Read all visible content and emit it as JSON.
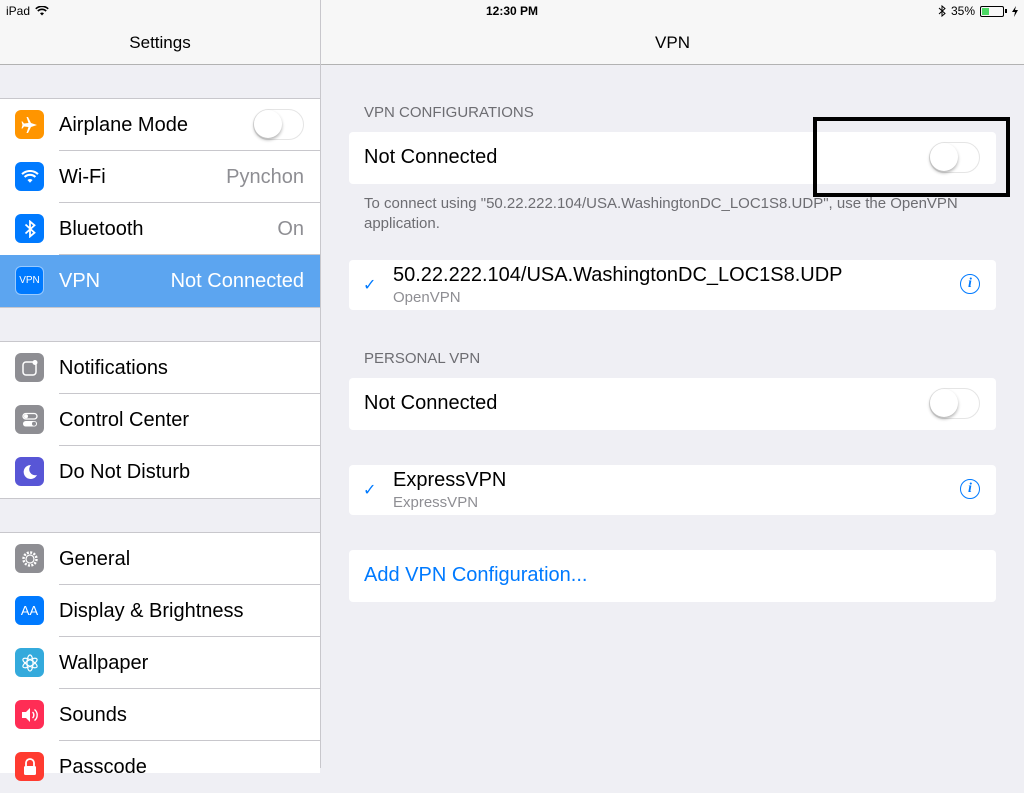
{
  "status_bar": {
    "device": "iPad",
    "time": "12:30 PM",
    "battery": "35%",
    "battery_level": 0.35,
    "icons": [
      "wifi-icon",
      "bluetooth-icon",
      "battery-icon",
      "charging-icon"
    ]
  },
  "sidebar": {
    "title": "Settings",
    "groups": [
      {
        "items": [
          {
            "label": "Airplane Mode",
            "value": "",
            "icon": "airplane-icon",
            "color": "#ff9500",
            "toggle": false
          },
          {
            "label": "Wi-Fi",
            "value": "Pynchon",
            "icon": "wifi-icon",
            "color": "#007aff"
          },
          {
            "label": "Bluetooth",
            "value": "On",
            "icon": "bluetooth-icon",
            "color": "#007aff"
          },
          {
            "label": "VPN",
            "value": "Not Connected",
            "icon": "vpn-icon",
            "icon_text": "VPN",
            "color": "#007aff",
            "selected": true
          }
        ]
      },
      {
        "items": [
          {
            "label": "Notifications",
            "icon": "notifications-icon",
            "color": "#8e8e93"
          },
          {
            "label": "Control Center",
            "icon": "control-center-icon",
            "color": "#8e8e93"
          },
          {
            "label": "Do Not Disturb",
            "icon": "moon-icon",
            "color": "#5856d6"
          }
        ]
      },
      {
        "items": [
          {
            "label": "General",
            "icon": "gear-icon",
            "color": "#8e8e93"
          },
          {
            "label": "Display & Brightness",
            "icon": "display-icon",
            "icon_text": "AA",
            "color": "#007aff"
          },
          {
            "label": "Wallpaper",
            "icon": "wallpaper-icon",
            "color": "#34aadc"
          },
          {
            "label": "Sounds",
            "icon": "sounds-icon",
            "color": "#ff2d55"
          },
          {
            "label": "Passcode",
            "icon": "lock-icon",
            "color": "#ff3b30"
          }
        ]
      }
    ]
  },
  "main": {
    "title": "VPN",
    "vpn_configurations": {
      "header": "VPN CONFIGURATIONS",
      "status": "Not Connected",
      "toggle": false,
      "footnote": "To connect using \"50.22.222.104/USA.WashingtonDC_LOC1S8.UDP\", use the OpenVPN application.",
      "config": {
        "name": "50.22.222.104/USA.WashingtonDC_LOC1S8.UDP",
        "type": "OpenVPN"
      }
    },
    "personal_vpn": {
      "header": "PERSONAL VPN",
      "status": "Not Connected",
      "toggle": false,
      "config": {
        "name": "ExpressVPN",
        "type": "ExpressVPN"
      }
    },
    "add_config": "Add VPN Configuration...",
    "check_glyph": "✓",
    "info_glyph": "i"
  }
}
